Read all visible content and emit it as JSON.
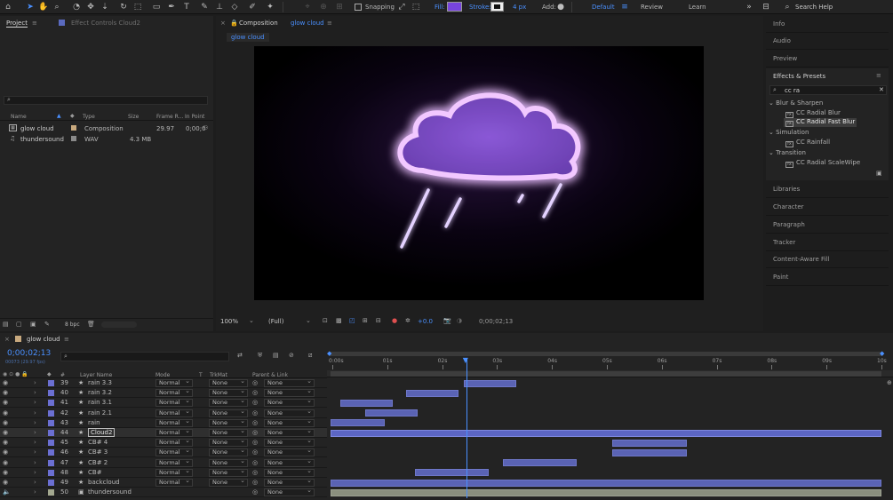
{
  "toolbar": {
    "snapping": "Snapping",
    "fill_label": "Fill:",
    "stroke_label": "Stroke:",
    "stroke_width": "4 px",
    "add_label": "Add:",
    "workspaces": [
      "Default",
      "Review",
      "Learn"
    ],
    "search_placeholder": "Search Help",
    "fill_color": "#7744dd"
  },
  "project_panel": {
    "tab": "Project",
    "effect_controls_tab": "Effect Controls Cloud2",
    "columns": [
      "Name",
      "Type",
      "Size",
      "Frame R...",
      "In Point"
    ],
    "items": [
      {
        "name": "glow cloud",
        "type": "Composition",
        "size": "",
        "frame_rate": "29.97",
        "in_point": "0;00;0",
        "color": "#c8a97e"
      },
      {
        "name": "thundersound",
        "type": "WAV",
        "size": "4.3 MB",
        "frame_rate": "",
        "in_point": "",
        "color": "#8a8a8a"
      }
    ],
    "bpc": "8 bpc"
  },
  "composition_panel": {
    "tab_prefix": "Composition",
    "tab_name": "glow cloud",
    "subtab": "glow cloud",
    "zoom": "100%",
    "resolution": "(Full)",
    "exposure": "+0.0",
    "timecode": "0;00;02;13"
  },
  "right_panel": {
    "top_items": [
      "Info",
      "Audio",
      "Preview"
    ],
    "effects_title": "Effects & Presets",
    "search_value": "cc ra",
    "groups": [
      {
        "name": "Blur & Sharpen",
        "items": [
          "CC Radial Blur",
          "CC Radial Fast Blur"
        ]
      },
      {
        "name": "Simulation",
        "items": [
          "CC Rainfall"
        ]
      },
      {
        "name": "Transition",
        "items": [
          "CC Radial ScaleWipe"
        ]
      }
    ],
    "bottom_items": [
      "Libraries",
      "Character",
      "Paragraph",
      "Tracker",
      "Content-Aware Fill",
      "Paint"
    ]
  },
  "timeline": {
    "comp_tab": "glow cloud",
    "timecode": "0;00;02;13",
    "frame_info": "00073 (29.97 fps)",
    "columns": {
      "num": "#",
      "layer_name": "Layer Name",
      "mode": "Mode",
      "t": "T",
      "trkmat": "TrkMat",
      "parent": "Parent & Link"
    },
    "ruler_labels": [
      "0:00s",
      "01s",
      "02s",
      "03s",
      "04s",
      "05s",
      "06s",
      "07s",
      "08s",
      "09s",
      "10s"
    ],
    "playhead_seconds": 2.44,
    "duration_seconds": 10,
    "layers": [
      {
        "num": "39",
        "name": "rain 3.3",
        "mode": "Normal",
        "trkmat": "None",
        "parent": "None",
        "start": 2.4,
        "end": 3.35,
        "color": "#6b6fd2"
      },
      {
        "num": "40",
        "name": "rain 3.2",
        "mode": "Normal",
        "trkmat": "None",
        "parent": "None",
        "start": 1.35,
        "end": 2.3,
        "color": "#6b6fd2"
      },
      {
        "num": "41",
        "name": "rain 3.1",
        "mode": "Normal",
        "trkmat": "None",
        "parent": "None",
        "start": 0.15,
        "end": 1.1,
        "color": "#6b6fd2"
      },
      {
        "num": "42",
        "name": "rain 2.1",
        "mode": "Normal",
        "trkmat": "None",
        "parent": "None",
        "start": 0.6,
        "end": 1.55,
        "color": "#6b6fd2"
      },
      {
        "num": "43",
        "name": "rain",
        "mode": "Normal",
        "trkmat": "None",
        "parent": "None",
        "start": 0.0,
        "end": 0.95,
        "color": "#6b6fd2"
      },
      {
        "num": "44",
        "name": "Cloud2",
        "mode": "Normal",
        "trkmat": "None",
        "parent": "None",
        "start": 0.0,
        "end": 10.0,
        "color": "#6b6fd2",
        "selected": true
      },
      {
        "num": "45",
        "name": "CB# 4",
        "mode": "Normal",
        "trkmat": "None",
        "parent": "None",
        "start": 5.1,
        "end": 6.45,
        "color": "#6b6fd2"
      },
      {
        "num": "46",
        "name": "CB# 3",
        "mode": "Normal",
        "trkmat": "None",
        "parent": "None",
        "start": 5.1,
        "end": 6.45,
        "color": "#6b6fd2"
      },
      {
        "num": "47",
        "name": "CB# 2",
        "mode": "Normal",
        "trkmat": "None",
        "parent": "None",
        "start": 3.1,
        "end": 4.45,
        "color": "#6b6fd2"
      },
      {
        "num": "48",
        "name": "CB#",
        "mode": "Normal",
        "trkmat": "None",
        "parent": "None",
        "start": 1.5,
        "end": 2.85,
        "color": "#6b6fd2"
      },
      {
        "num": "49",
        "name": "backcloud",
        "mode": "Normal",
        "trkmat": "None",
        "parent": "None",
        "start": 0.0,
        "end": 10.0,
        "color": "#6b6fd2"
      },
      {
        "num": "50",
        "name": "thundersound",
        "mode": "",
        "trkmat": "",
        "parent": "None",
        "start": 0.0,
        "end": 10.0,
        "color": "#a3a88f",
        "audio": true
      }
    ]
  }
}
